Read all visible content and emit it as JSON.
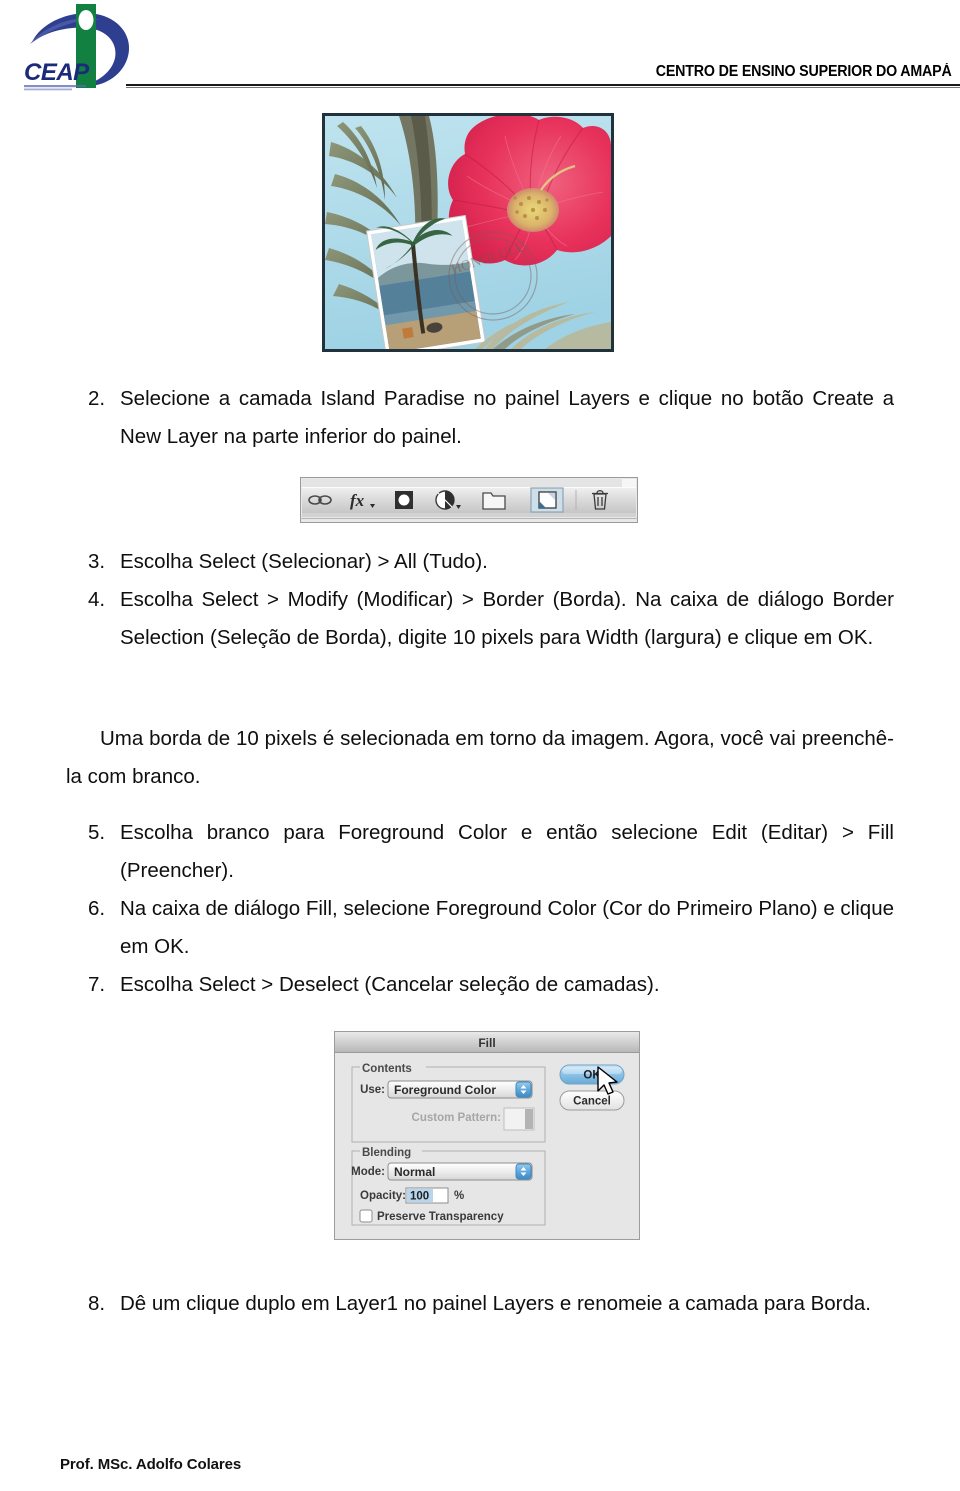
{
  "header": {
    "institution_title": "CENTRO DE ENSINO SUPERIOR DO AMAPÁ",
    "logo": {
      "wordmark": "CEAP",
      "tagline": "CENTRO DE ENSINO SUPERIOR DO AMAPÁ",
      "colors": {
        "swoosh": "#2e3f8f",
        "bar": "#128040",
        "wordmark": "#1b2a7a"
      }
    }
  },
  "figures": {
    "island_paradise": {
      "caption": "Imagem Island Paradise com flor de hibisco rosa e cartao postal",
      "border_color": "#22323c"
    },
    "layers_toolbar": {
      "caption": "Barra inferior do painel Layers",
      "icons": [
        {
          "name": "link-layers-icon",
          "label": "Link Layers"
        },
        {
          "name": "layer-style-fx-icon",
          "label": "fx"
        },
        {
          "name": "layer-mask-icon",
          "label": "Add Layer Mask"
        },
        {
          "name": "adjustment-layer-icon",
          "label": "New Fill or Adjustment Layer"
        },
        {
          "name": "new-group-icon",
          "label": "Create a New Group"
        },
        {
          "name": "create-new-layer-icon",
          "label": "Create a New Layer"
        },
        {
          "name": "delete-layer-icon",
          "label": "Delete Layer"
        }
      ],
      "highlighted_icon": "create-new-layer-icon"
    }
  },
  "fill_dialog": {
    "title": "Fill",
    "contents_group": "Contents",
    "use_label": "Use:",
    "use_value": "Foreground Color",
    "custom_pattern_label": "Custom Pattern:",
    "blending_group": "Blending",
    "mode_label": "Mode:",
    "mode_value": "Normal",
    "opacity_label": "Opacity:",
    "opacity_value": "100",
    "opacity_unit": "%",
    "preserve_transparency_label": "Preserve Transparency",
    "preserve_transparency_checked": false,
    "ok_button": "OK",
    "cancel_button": "Cancel",
    "accent_color": "#5fa8dc"
  },
  "steps": [
    {
      "number": "2.",
      "text": "Selecione a camada Island Paradise no painel Layers e clique no botão Create a New Layer na parte inferior do painel."
    },
    {
      "number": "3.",
      "text": "Escolha Select (Selecionar) > All (Tudo)."
    },
    {
      "number": "4.",
      "text": "Escolha Select > Modify (Modificar) > Border (Borda). Na caixa de diálogo Border Selection (Seleção de Borda), digite 10 pixels para Width (largura) e clique em OK."
    },
    {
      "number": "5.",
      "text": "Escolha branco para Foreground Color e então selecione Edit (Editar) > Fill (Preencher)."
    },
    {
      "number": "6.",
      "text": "Na caixa de diálogo Fill, selecione Foreground Color (Cor do Primeiro Plano) e clique em OK."
    },
    {
      "number": "7.",
      "text": "Escolha Select > Deselect (Cancelar seleção de camadas)."
    },
    {
      "number": "8.",
      "text": "Dê um clique duplo em Layer1 no painel Layers e renomeie a camada para Borda."
    }
  ],
  "note_paragraph": "Uma borda de 10 pixels é selecionada em torno da imagem. Agora, você vai preenchê-la com branco.",
  "footer": {
    "author": "Prof. MSc. Adolfo Colares"
  }
}
